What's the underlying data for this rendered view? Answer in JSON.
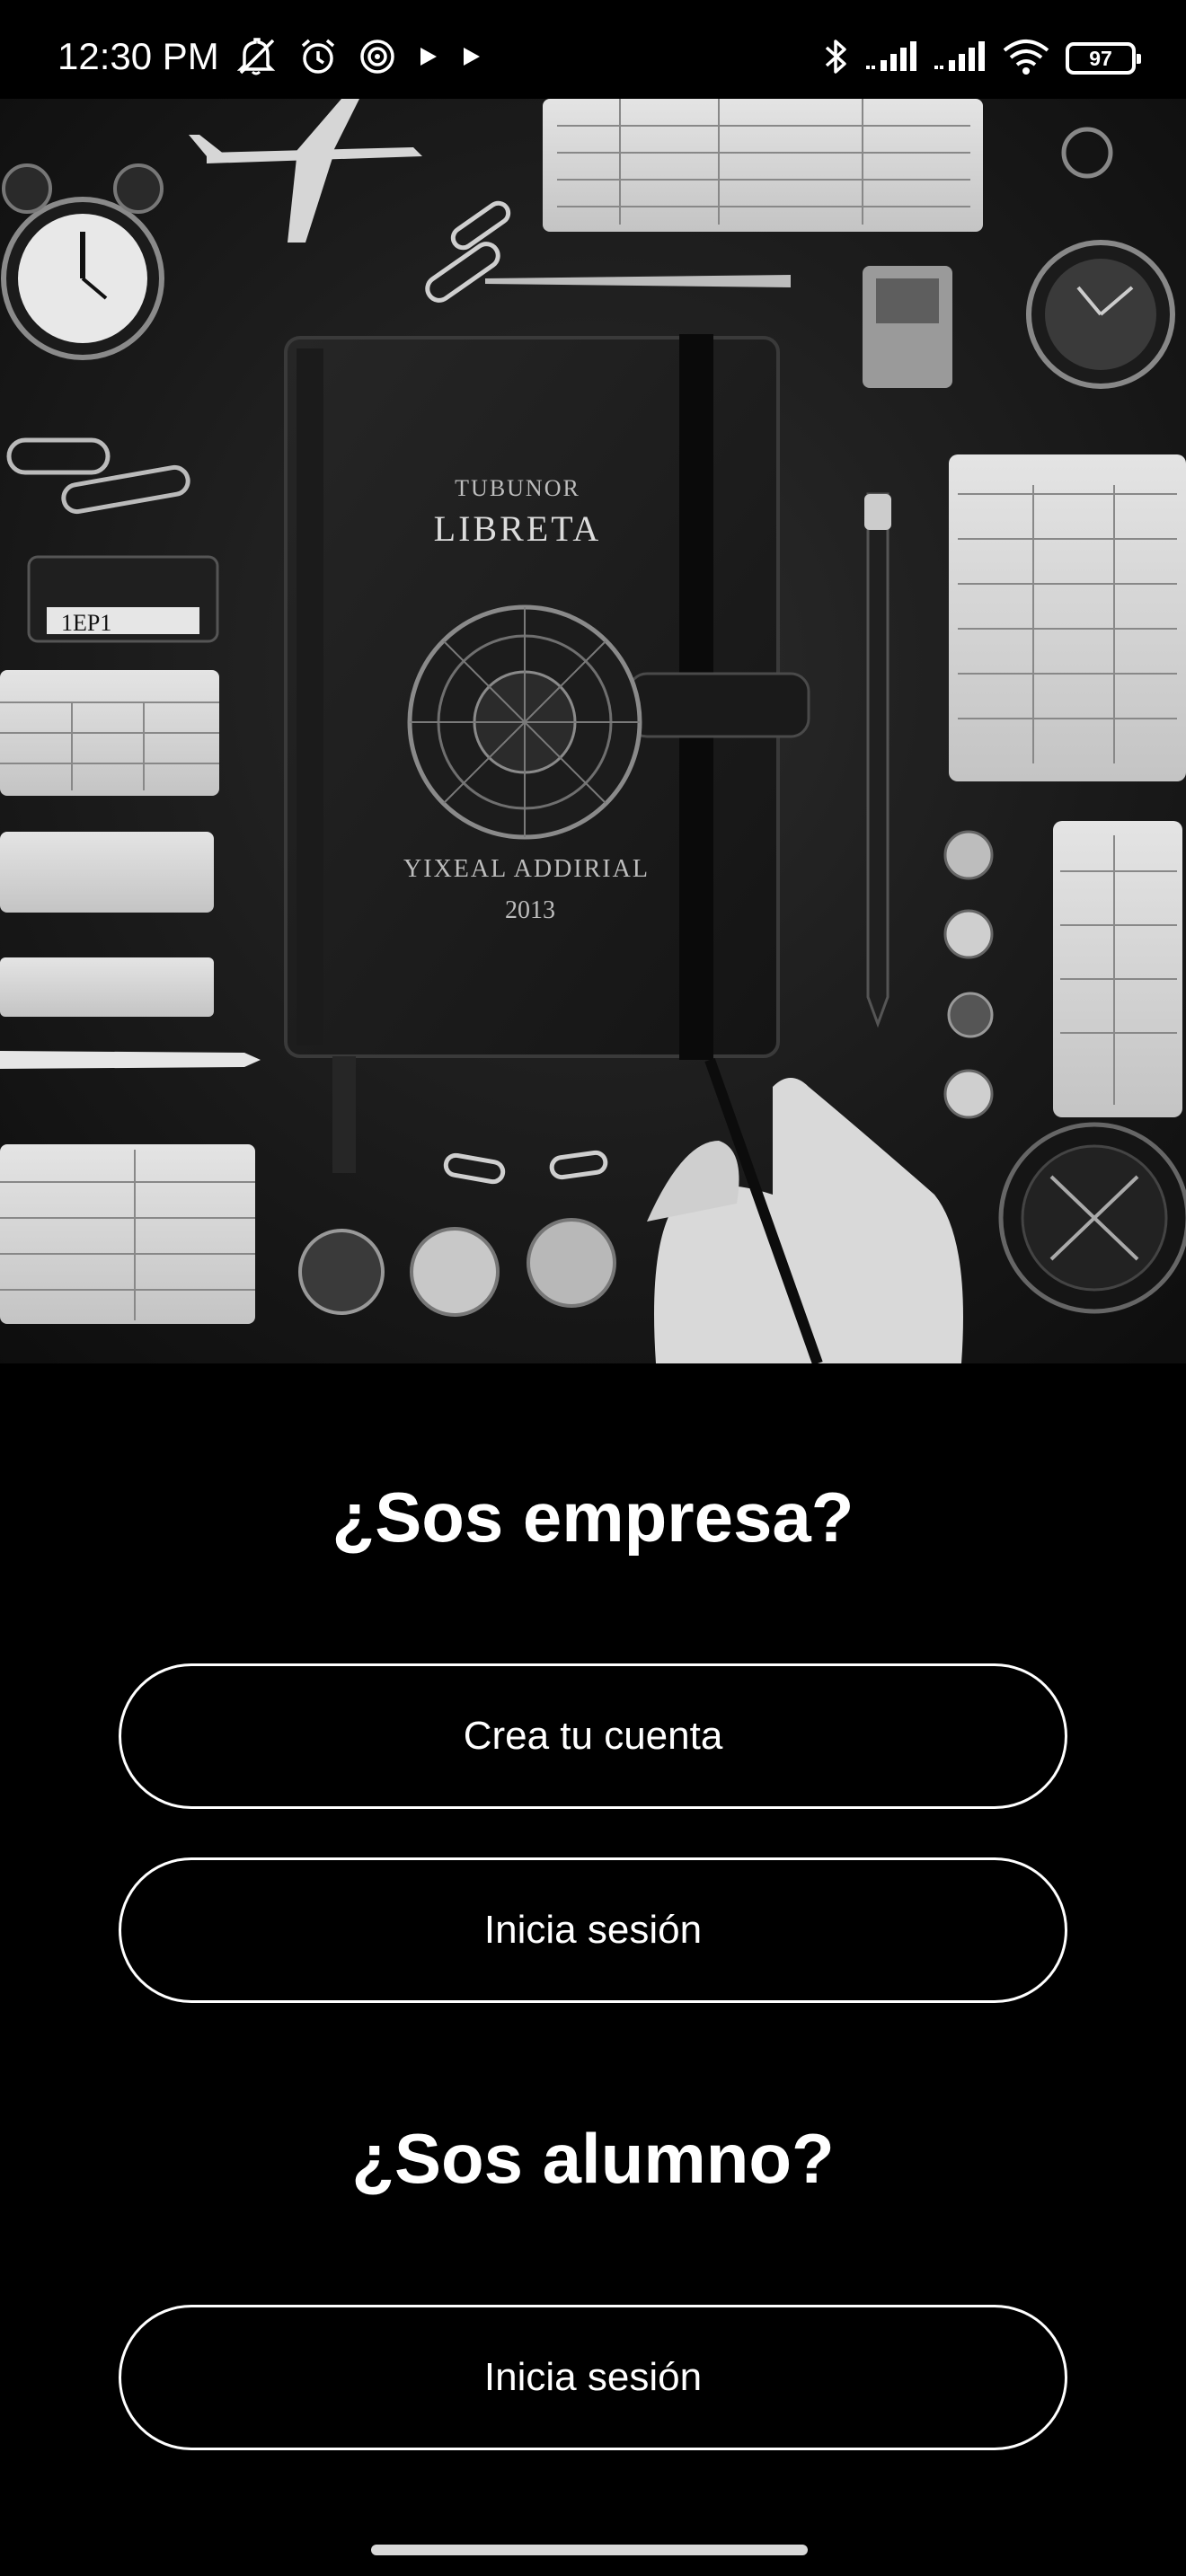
{
  "status_bar": {
    "time": "12:30 PM",
    "battery": "97",
    "left_icons": [
      "mute-icon",
      "alarm-icon",
      "sync-icon",
      "play-icon",
      "play-icon"
    ],
    "right_icons": [
      "bluetooth-icon",
      "signal-icon",
      "signal-icon",
      "wifi-icon",
      "battery-icon"
    ]
  },
  "hero": {
    "description_icon": "notebook-flatlay-image",
    "notebook_label_top": "TUBUNOR",
    "notebook_title": "LIBRETA",
    "notebook_subtitle": "YIXEAL ADDIRIAL",
    "notebook_year": "2013",
    "card_text": "1EP1"
  },
  "company": {
    "heading": "¿Sos empresa?",
    "create_account_label": "Crea tu cuenta",
    "login_label": "Inicia sesión"
  },
  "student": {
    "heading": "¿Sos alumno?",
    "login_label": "Inicia sesión"
  },
  "colors": {
    "background": "#000000",
    "text": "#ffffff",
    "button_border": "#ffffff"
  }
}
